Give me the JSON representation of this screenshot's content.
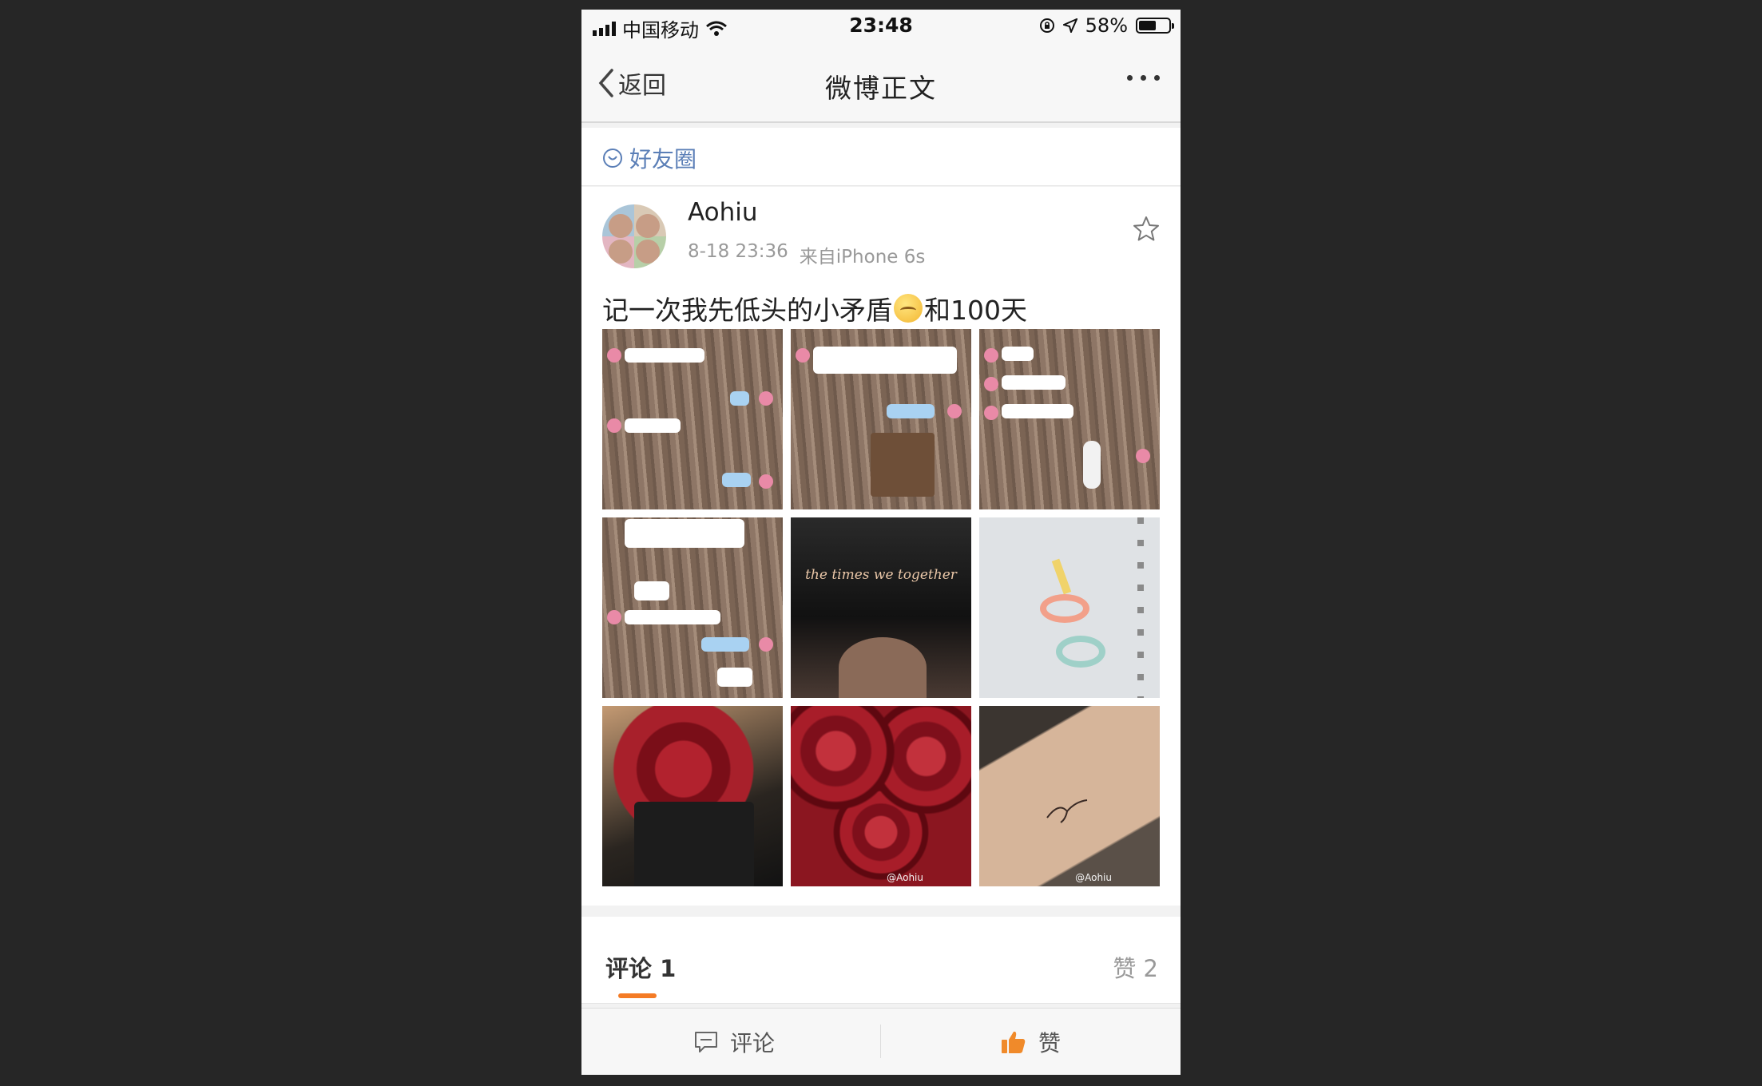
{
  "status_bar": {
    "carrier": "中国移动",
    "time": "23:48",
    "battery_percent": "58%",
    "battery_level": 0.58
  },
  "nav": {
    "back_label": "返回",
    "title": "微博正文"
  },
  "circle": {
    "label": "好友圈"
  },
  "post": {
    "username": "Aohiu",
    "time": "8-18 23:36",
    "source": "来自iPhone 6s",
    "text_before": "记一次我先低头的小矛盾",
    "text_after": "和100天",
    "images": [
      {
        "kind": "chat-screenshot"
      },
      {
        "kind": "chat-screenshot"
      },
      {
        "kind": "chat-screenshot"
      },
      {
        "kind": "chat-screenshot"
      },
      {
        "kind": "photo-card",
        "caption": "the times we together"
      },
      {
        "kind": "notebook-100"
      },
      {
        "kind": "rose-bouquet"
      },
      {
        "kind": "roses",
        "watermark": "@Aohiu"
      },
      {
        "kind": "tattoo",
        "watermark": "@Aohiu"
      }
    ]
  },
  "tabs": {
    "comments_label": "评论",
    "comments_count": "1",
    "likes_label": "赞",
    "likes_count": "2"
  },
  "toolbar": {
    "comment_label": "评论",
    "like_label": "赞"
  },
  "colors": {
    "accent": "#f47b25",
    "link_blue": "#5b7fb7",
    "like_orange": "#f08a2a"
  }
}
